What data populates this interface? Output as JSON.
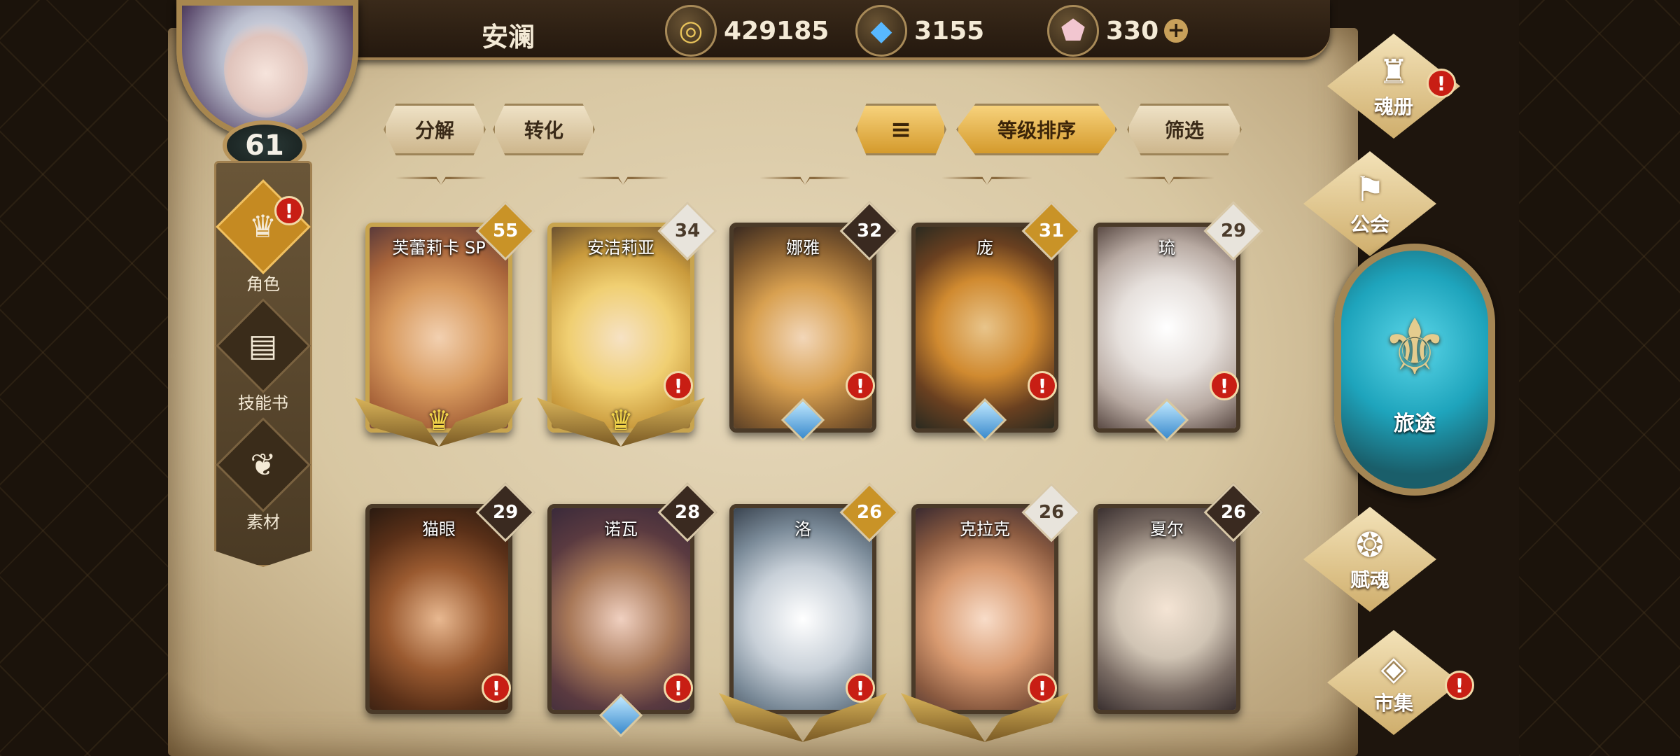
{
  "player": {
    "name": "安澜",
    "level": "61"
  },
  "resources": [
    {
      "icon": "gold-coin-icon",
      "value": "429185"
    },
    {
      "icon": "blue-crystal-icon",
      "value": "3155"
    },
    {
      "icon": "pink-gem-icon",
      "value": "330"
    }
  ],
  "left_tabs": [
    {
      "label": "角色",
      "icon": "character-icon",
      "active": true,
      "alert": "!"
    },
    {
      "label": "技能书",
      "icon": "skill-book-icon",
      "active": false
    },
    {
      "label": "素材",
      "icon": "material-icon",
      "active": false
    }
  ],
  "toolbar": {
    "decompose": "分解",
    "convert": "转化",
    "sort_by_level": "等级排序",
    "filter": "筛选"
  },
  "cards": [
    {
      "name": "芙蕾莉卡 SP",
      "level": "55",
      "level_style": "gold",
      "frame": "gold",
      "bottom": "crown",
      "alert": false
    },
    {
      "name": "安洁莉亚",
      "level": "34",
      "level_style": "white",
      "frame": "gold",
      "bottom": "crown",
      "alert": true
    },
    {
      "name": "娜雅",
      "level": "32",
      "level_style": "dark",
      "frame": "dark",
      "bottom": "gem",
      "alert": true
    },
    {
      "name": "庞",
      "level": "31",
      "level_style": "gold",
      "frame": "dark",
      "bottom": "gem",
      "alert": true
    },
    {
      "name": "琉",
      "level": "29",
      "level_style": "white",
      "frame": "dark",
      "bottom": "gem",
      "alert": true
    },
    {
      "name": "猫眼",
      "level": "29",
      "level_style": "dark",
      "frame": "dark",
      "bottom": "none",
      "alert": true
    },
    {
      "name": "诺瓦",
      "level": "28",
      "level_style": "dark",
      "frame": "dark",
      "bottom": "gem",
      "alert": true
    },
    {
      "name": "洛",
      "level": "26",
      "level_style": "gold",
      "frame": "dark",
      "bottom": "crown",
      "alert": true
    },
    {
      "name": "克拉克",
      "level": "26",
      "level_style": "white",
      "frame": "dark",
      "bottom": "crown",
      "alert": true
    },
    {
      "name": "夏尔",
      "level": "26",
      "level_style": "dark",
      "frame": "dark",
      "bottom": "none",
      "alert": false
    }
  ],
  "right_nav": {
    "soul_book": "魂册",
    "guild": "公会",
    "journey": "旅途",
    "endow_soul": "赋魂",
    "market": "市集"
  },
  "alert_mark": "!",
  "plus_mark": "+",
  "colors": {
    "accent_gold": "#d49a2c",
    "alert_red": "#c81e14",
    "parchment": "#e6d8bb"
  }
}
